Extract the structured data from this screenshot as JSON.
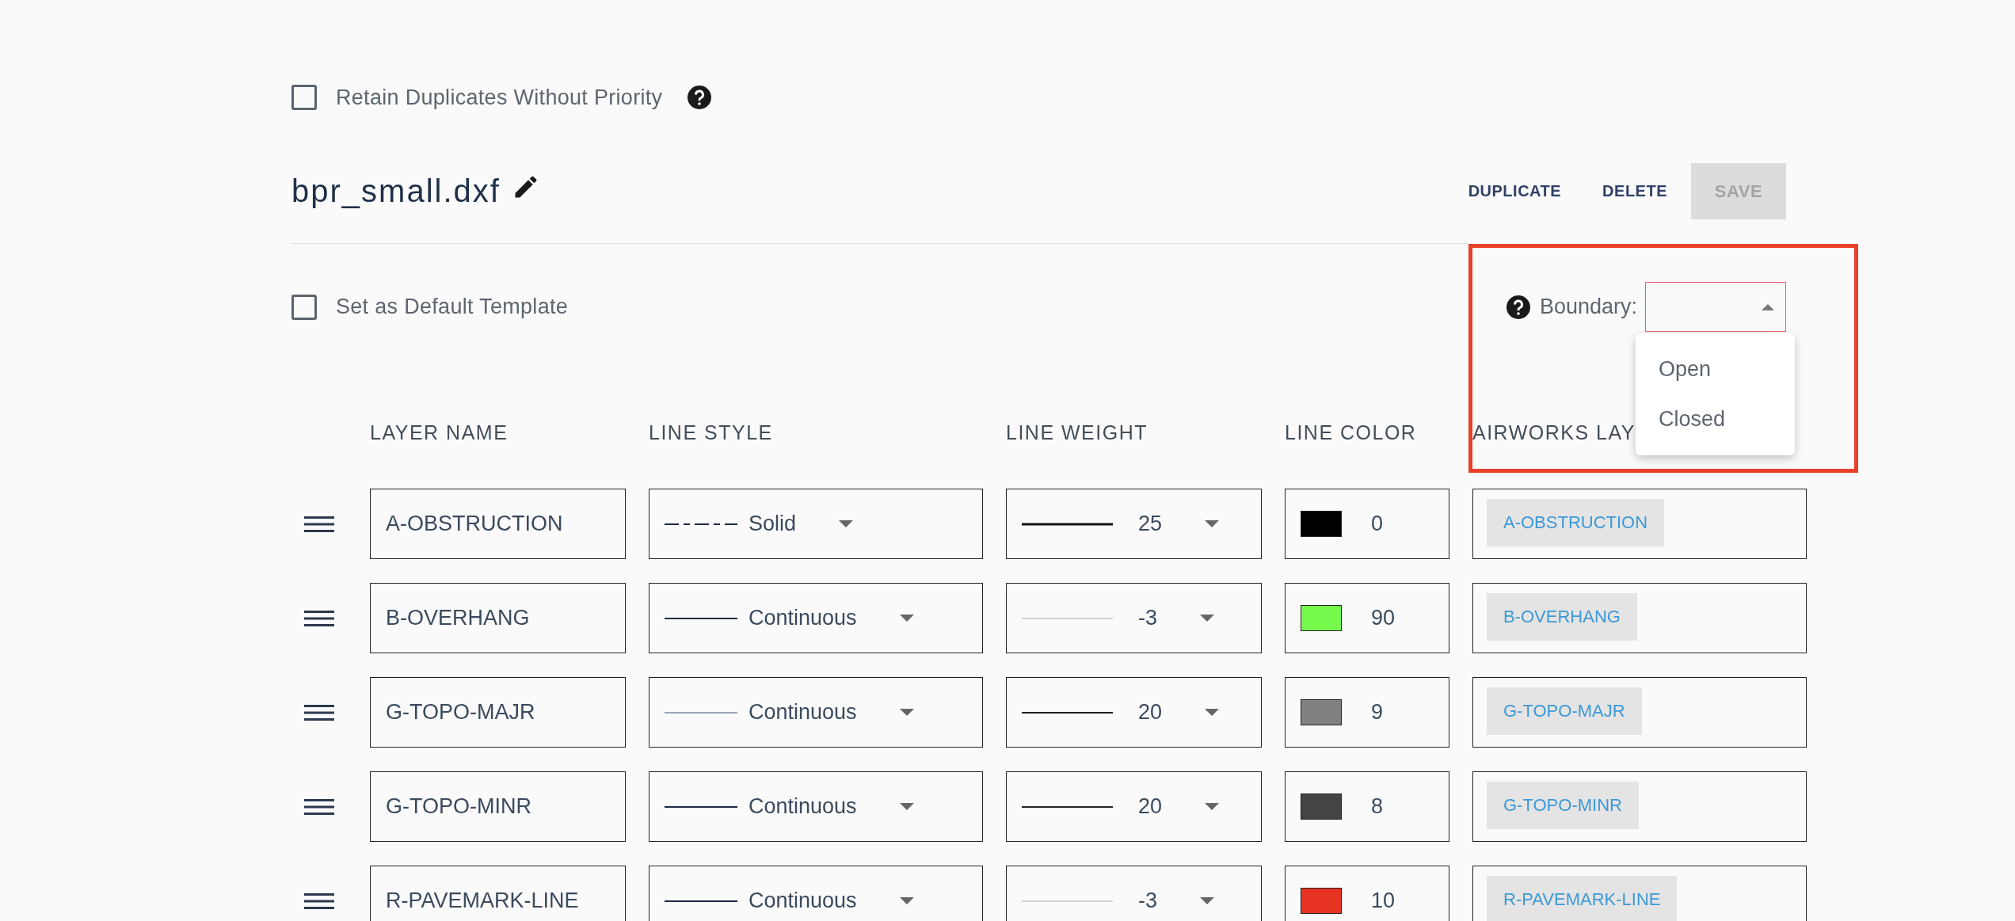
{
  "retain_duplicates": {
    "label": "Retain Duplicates Without Priority",
    "checked": false
  },
  "template": {
    "name": "bpr_small.dxf"
  },
  "buttons": [
    {
      "label": "DUPLICATE",
      "disabled": false
    },
    {
      "label": "DELETE",
      "disabled": false
    },
    {
      "label": "SAVE",
      "disabled": true
    }
  ],
  "default_template": {
    "label": "Set as Default Template",
    "checked": false
  },
  "boundary": {
    "label": "Boundary:",
    "invalid": true,
    "expanded": true,
    "options": [
      {
        "label": "Open",
        "selected": false
      },
      {
        "label": "Closed",
        "selected": false
      }
    ]
  },
  "table": {
    "columns": [
      "LAYER NAME",
      "LINE STYLE",
      "LINE WEIGHT",
      "LINE COLOR",
      "AIRWORKS LAY"
    ],
    "rows": [
      {
        "layer_name": "A-OBSTRUCTION",
        "line_style": {
          "kind": "dashed",
          "label": "Solid"
        },
        "line_weight": {
          "kind": "heavy",
          "value": "25"
        },
        "line_color": {
          "color": "#000000",
          "index": "0"
        },
        "airworks_layer": "A-OBSTRUCTION"
      },
      {
        "layer_name": "B-OVERHANG",
        "line_style": {
          "kind": "solid",
          "label": "Continuous"
        },
        "line_weight": {
          "kind": "hairline",
          "value": "-3"
        },
        "line_color": {
          "color": "#76f94c",
          "index": "90"
        },
        "airworks_layer": "B-OVERHANG"
      },
      {
        "layer_name": "G-TOPO-MAJR",
        "line_style": {
          "kind": "thin",
          "label": "Continuous"
        },
        "line_weight": {
          "kind": "medium",
          "value": "20"
        },
        "line_color": {
          "color": "#808080",
          "index": "9"
        },
        "airworks_layer": "G-TOPO-MAJR"
      },
      {
        "layer_name": "G-TOPO-MINR",
        "line_style": {
          "kind": "solid",
          "label": "Continuous"
        },
        "line_weight": {
          "kind": "medium",
          "value": "20"
        },
        "line_color": {
          "color": "#444444",
          "index": "8"
        },
        "airworks_layer": "G-TOPO-MINR"
      },
      {
        "layer_name": "R-PAVEMARK-LINE",
        "line_style": {
          "kind": "solid",
          "label": "Continuous"
        },
        "line_weight": {
          "kind": "hairline",
          "value": "-3"
        },
        "line_color": {
          "color": "#e63322",
          "index": "10"
        },
        "airworks_layer": "R-PAVEMARK-LINE"
      }
    ]
  }
}
